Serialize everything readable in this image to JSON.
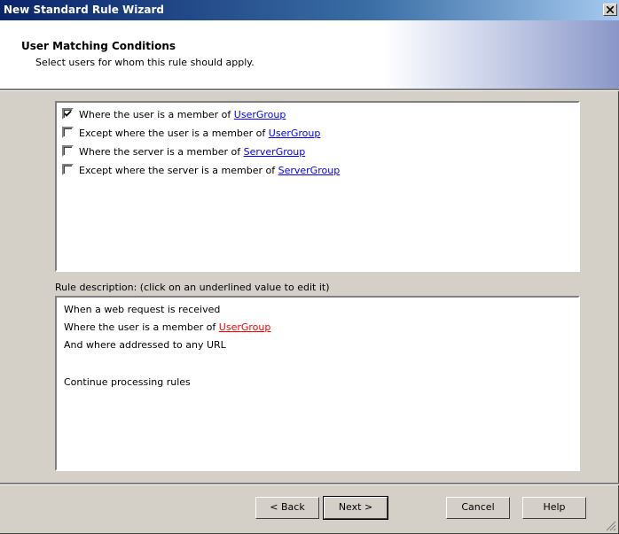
{
  "window": {
    "title": "New Standard Rule Wizard"
  },
  "header": {
    "title": "User Matching Conditions",
    "subtitle": "Select users for whom this rule should apply."
  },
  "conditions": [
    {
      "checked": true,
      "prefix": "Where the user is a member of ",
      "link": "UserGroup"
    },
    {
      "checked": false,
      "prefix": "Except where the user is a member of ",
      "link": "UserGroup"
    },
    {
      "checked": false,
      "prefix": "Where the server is a member of ",
      "link": "ServerGroup"
    },
    {
      "checked": false,
      "prefix": "Except where the server is a member of ",
      "link": "ServerGroup"
    }
  ],
  "description": {
    "label": "Rule description: (click on an underlined value to edit it)",
    "line1": "When a web request is received",
    "line2_prefix": "Where the user is a member of ",
    "line2_link": "UserGroup",
    "line3": "And where addressed to any URL",
    "line4": "Continue processing rules"
  },
  "buttons": {
    "back": "< Back",
    "next": "Next >",
    "cancel": "Cancel",
    "help": "Help"
  },
  "colors": {
    "link": "#0000ff",
    "link_highlight": "#ff0000",
    "titlebar": "#0a246a",
    "face": "#d4d0c8"
  }
}
